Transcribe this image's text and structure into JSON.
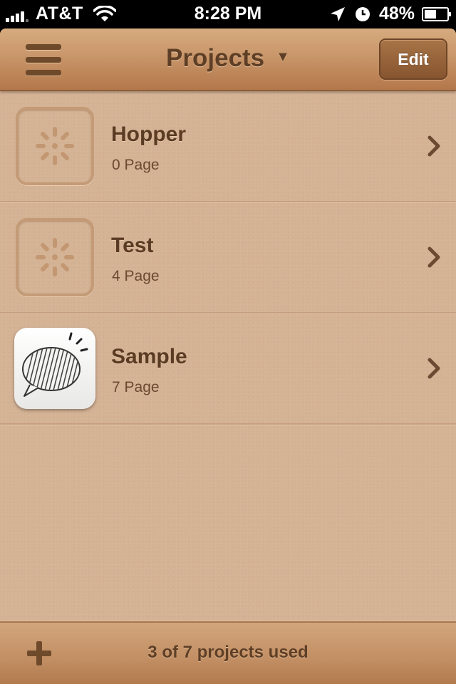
{
  "status_bar": {
    "carrier": "AT&T",
    "time": "8:28 PM",
    "battery": "48%",
    "icons": [
      "signal-icon",
      "wifi-icon",
      "location-arrow-icon",
      "alarm-clock-icon",
      "battery-icon"
    ]
  },
  "navbar": {
    "title": "Projects",
    "caret": "▼",
    "edit_label": "Edit",
    "menu_icon": "hamburger-menu-icon"
  },
  "projects": [
    {
      "name": "Hopper",
      "pages": "0 Page",
      "thumb_icon": "loading-spinner-icon"
    },
    {
      "name": "Test",
      "pages": "4 Page",
      "thumb_icon": "loading-spinner-icon"
    },
    {
      "name": "Sample",
      "pages": "7 Page",
      "thumb_icon": "speech-bubble-sketch-icon"
    }
  ],
  "bottom_bar": {
    "add_icon": "plus-icon",
    "usage": "3 of 7 projects used"
  },
  "colors": {
    "background": "#d4b294",
    "navbar": "#c8966a",
    "text_dark": "#5a3b23",
    "edit_button": "#8e5a34"
  }
}
